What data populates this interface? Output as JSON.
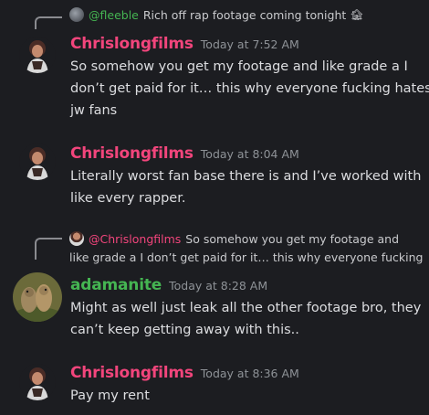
{
  "messages": [
    {
      "reply": {
        "mention": "@fleeble",
        "text": "Rich off rap footage coming tonight",
        "icon": "house-emoji-icon"
      },
      "author": "Chrislongfilms",
      "timestamp": "Today at 7:52 AM",
      "lines": [
        "So somehow you get my footage and like grade a I",
        "don’t get paid for it… this why everyone fucking hates",
        "jw fans"
      ]
    },
    {
      "author": "Chrislongfilms",
      "timestamp": "Today at 8:04 AM",
      "lines": [
        "Literally worst fan base there is and I’ve worked with",
        "like every rapper."
      ]
    },
    {
      "reply": {
        "mention": "@Chrislongfilms",
        "lines": [
          "So somehow you get my footage and",
          "like grade a I don’t get paid for it… this why everyone fucking"
        ]
      },
      "author": "adamanite",
      "timestamp": "Today at 8:28 AM",
      "lines": [
        "Might as well just leak all the other footage bro, they",
        "can’t keep getting away with this.."
      ]
    },
    {
      "author": "Chrislongfilms",
      "timestamp": "Today at 8:36 AM",
      "lines": [
        "Pay my rent"
      ]
    }
  ],
  "colors": {
    "background": "#1c1d21",
    "chrislongfilms": "#f2457c",
    "adamanite": "#45b552",
    "timestamp": "#8e9297"
  }
}
